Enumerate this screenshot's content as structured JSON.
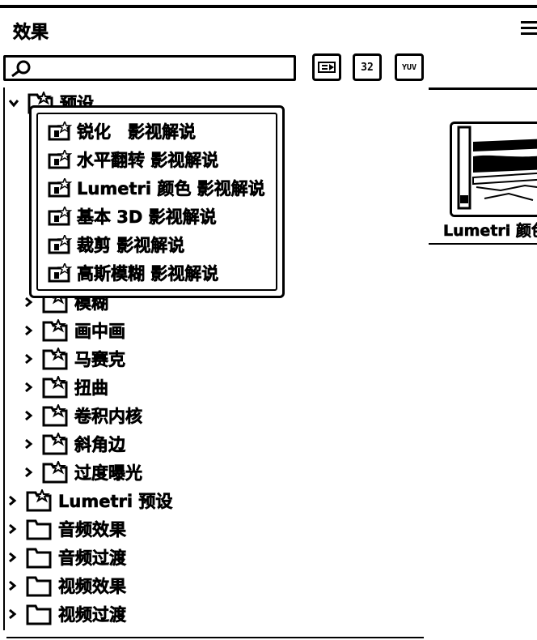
{
  "panel": {
    "title": "效果",
    "menu_icon": "hamburger-menu-icon"
  },
  "search": {
    "value": "",
    "placeholder": "",
    "icon": "search-icon"
  },
  "toolbar": [
    {
      "name": "accelerated-effects-button",
      "icon": "accelerated-icon",
      "text": ""
    },
    {
      "name": "32bit-effects-button",
      "icon": "32-icon",
      "text": "32"
    },
    {
      "name": "yuv-effects-button",
      "icon": "yuv-icon",
      "text": "YUV"
    }
  ],
  "tree": {
    "presets": {
      "label": "预设",
      "expanded": true
    },
    "preset_items": [
      {
        "label": "锐化　影视解说"
      },
      {
        "label": "水平翻转 影视解说"
      },
      {
        "label": "Lumetri 颜色 影视解说"
      },
      {
        "label": "基本 3D 影视解说"
      },
      {
        "label": "裁剪 影视解说"
      },
      {
        "label": "高斯模糊 影视解说"
      }
    ],
    "subfolders": [
      {
        "label": "模糊"
      },
      {
        "label": "画中画"
      },
      {
        "label": "马赛克"
      },
      {
        "label": "扭曲"
      },
      {
        "label": "卷积内核"
      },
      {
        "label": "斜角边"
      },
      {
        "label": "过度曝光"
      }
    ],
    "top_folders": [
      {
        "label": "Lumetri 预设",
        "starred": true
      },
      {
        "label": "音频效果",
        "starred": false
      },
      {
        "label": "音频过渡",
        "starred": false
      },
      {
        "label": "视频效果",
        "starred": false
      },
      {
        "label": "视频过渡",
        "starred": false
      }
    ]
  },
  "preview": {
    "label": "Lumetri 颜色"
  }
}
